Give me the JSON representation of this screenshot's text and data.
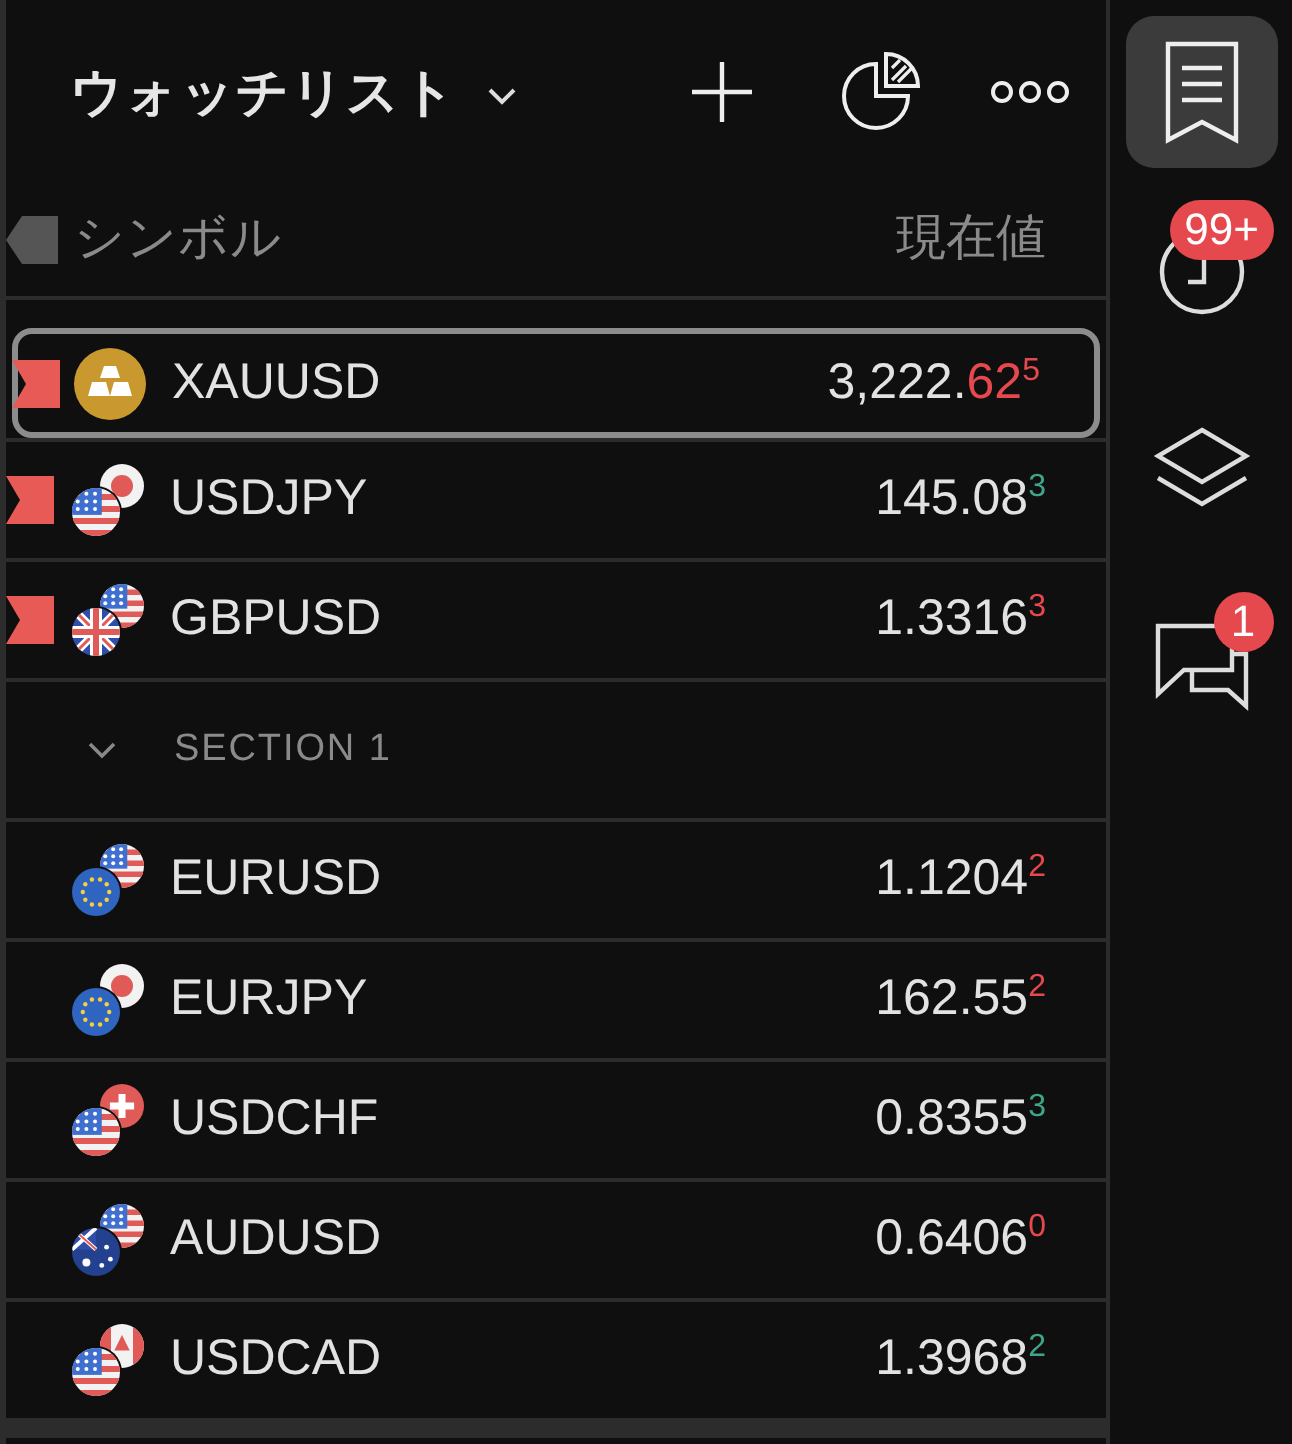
{
  "header": {
    "title": "ウォッチリスト"
  },
  "columns": {
    "symbol": "シンボル",
    "price": "現在値"
  },
  "rows": [
    {
      "symbol": "XAUUSD",
      "icon": {
        "kind": "bullion"
      },
      "flagged": true,
      "selected": true,
      "price": {
        "main": "3,222.",
        "big": "62",
        "pip": "5"
      },
      "color": "#e5484d"
    },
    {
      "symbol": "USDJPY",
      "icon": {
        "kind": "pair",
        "flags": [
          {
            "kind": "jp"
          },
          {
            "kind": "us"
          }
        ]
      },
      "flagged": true,
      "selected": false,
      "price": {
        "main": "145.08",
        "pip": "3"
      },
      "color": "#3fa58a"
    },
    {
      "symbol": "GBPUSD",
      "icon": {
        "kind": "pair",
        "flags": [
          {
            "kind": "us"
          },
          {
            "kind": "gb"
          }
        ]
      },
      "flagged": true,
      "selected": false,
      "price": {
        "main": "1.3316",
        "pip": "3"
      },
      "color": "#e5484d"
    }
  ],
  "sections": [
    {
      "title": "SECTION 1",
      "expanded": true,
      "rows": [
        {
          "symbol": "EURUSD",
          "icon": {
            "kind": "pair",
            "flags": [
              {
                "kind": "us"
              },
              {
                "kind": "eu"
              }
            ]
          },
          "flagged": false,
          "selected": false,
          "price": {
            "main": "1.1204",
            "pip": "2"
          },
          "color": "#e5484d"
        },
        {
          "symbol": "EURJPY",
          "icon": {
            "kind": "pair",
            "flags": [
              {
                "kind": "jp"
              },
              {
                "kind": "eu"
              }
            ]
          },
          "flagged": false,
          "selected": false,
          "price": {
            "main": "162.55",
            "pip": "2"
          },
          "color": "#e5484d"
        },
        {
          "symbol": "USDCHF",
          "icon": {
            "kind": "pair",
            "flags": [
              {
                "kind": "ch"
              },
              {
                "kind": "us"
              }
            ]
          },
          "flagged": false,
          "selected": false,
          "price": {
            "main": "0.8355",
            "pip": "3"
          },
          "color": "#3fa58a"
        },
        {
          "symbol": "AUDUSD",
          "icon": {
            "kind": "pair",
            "flags": [
              {
                "kind": "us"
              },
              {
                "kind": "au"
              }
            ]
          },
          "flagged": false,
          "selected": false,
          "price": {
            "main": "0.6406",
            "pip": "0"
          },
          "color": "#e5484d"
        },
        {
          "symbol": "USDCAD",
          "icon": {
            "kind": "pair",
            "flags": [
              {
                "kind": "ca"
              },
              {
                "kind": "us"
              }
            ]
          },
          "flagged": false,
          "selected": false,
          "price": {
            "main": "1.3968",
            "pip": "2"
          },
          "color": "#3fa58a"
        }
      ]
    }
  ],
  "sidebar": {
    "items": [
      {
        "kind": "watchlist",
        "selected": true
      },
      {
        "kind": "history",
        "selected": false,
        "badge": "99+"
      },
      {
        "kind": "layers",
        "selected": false
      },
      {
        "kind": "chat",
        "selected": false,
        "badge": "1"
      }
    ]
  }
}
